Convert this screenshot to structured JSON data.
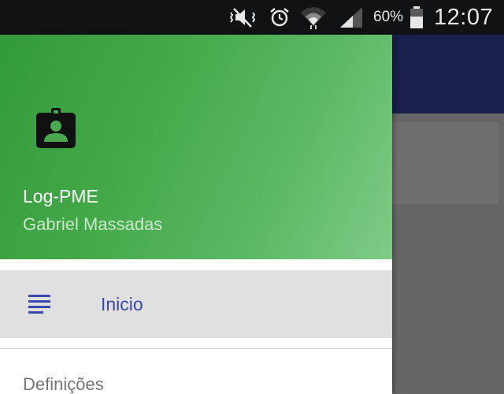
{
  "status_bar": {
    "icons": [
      "mute-vibrate-icon",
      "alarm-icon",
      "wifi-icon",
      "signal-icon",
      "battery-icon"
    ],
    "battery_percent": "60%",
    "time": "12:07"
  },
  "drawer": {
    "header": {
      "icon": "account-box-icon",
      "app_name": "Log-PME",
      "user_name": "Gabriel Massadas",
      "gradient_colors": [
        "#339a3c",
        "#7fcb85"
      ]
    },
    "menu": {
      "items": [
        {
          "label": "Inicio",
          "icon": "list-icon",
          "selected": true
        }
      ]
    },
    "section_label": "Definições"
  },
  "colors": {
    "accent": "#3949ab",
    "toolbar": "#1a1f4b",
    "scrim": "#666666"
  }
}
